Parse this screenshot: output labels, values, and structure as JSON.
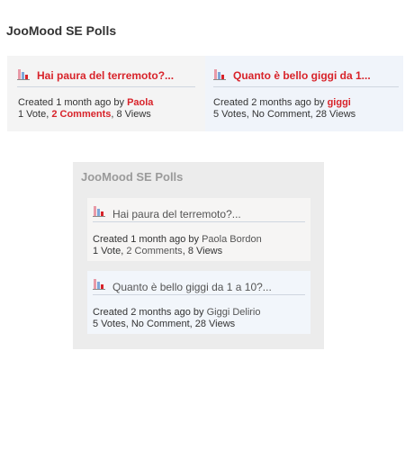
{
  "module_title": "JooMood SE Polls",
  "top_polls": [
    {
      "title": "Hai paura del terremoto?...",
      "created_prefix": "Created 1 month ago by ",
      "author": "Paola",
      "votes": "1 Vote",
      "comments": "2 Comments",
      "views": "8 Views"
    },
    {
      "title": "Quanto è bello giggi da 1...",
      "created_prefix": "Created 2 months ago by ",
      "author": "giggi",
      "votes": "5 Votes",
      "comments": "No Comment",
      "views": "28 Views"
    }
  ],
  "side_module_title": "JooMood SE Polls",
  "side_polls": [
    {
      "title": "Hai paura del terremoto?...",
      "created_prefix": "Created 1 month ago by ",
      "author": "Paola Bordon",
      "votes": "1 Vote",
      "comments": "2 Comments",
      "views": "8 Views"
    },
    {
      "title": "Quanto è bello giggi da 1 a 10?...",
      "created_prefix": "Created 2 months ago by ",
      "author": "Giggi Delirio",
      "votes": "5 Votes",
      "comments": "No Comment",
      "views": "28 Views"
    }
  ],
  "separator": ", ",
  "icon": "poll-chart-icon",
  "colors": {
    "accent": "#d8232a",
    "bar_pink": "#e89aa8",
    "bar_blue": "#7ea6d8",
    "bar_red": "#d8232a"
  }
}
